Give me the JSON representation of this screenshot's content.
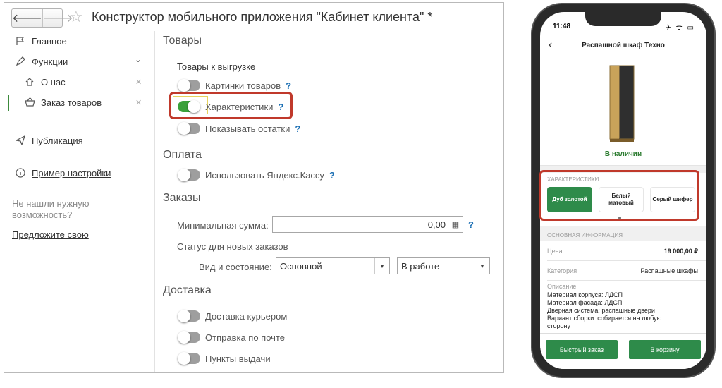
{
  "window": {
    "title": "Конструктор мобильного приложения \"Кабинет клиента\" *",
    "nav_back": "🡐",
    "nav_forward": "🡒"
  },
  "sidebar": {
    "items": [
      {
        "label": "Главное",
        "icon": "flag-icon"
      },
      {
        "label": "Функции",
        "icon": "pen-icon"
      },
      {
        "label": "О нас",
        "icon": "home-icon"
      },
      {
        "label": "Заказ товаров",
        "icon": "basket-icon"
      },
      {
        "label": "Публикация",
        "icon": "send-icon"
      },
      {
        "label": "Пример настройки",
        "icon": "info-icon"
      }
    ],
    "hint": "Не нашли нужную возможность?",
    "suggest_link": "Предложите свою"
  },
  "content": {
    "sections": {
      "goods": "Товары",
      "payment": "Оплата",
      "orders": "Заказы",
      "delivery": "Доставка"
    },
    "goods_export_link": "Товары к выгрузке",
    "toggles": {
      "product_images": {
        "label": "Картинки товаров",
        "on": false
      },
      "characteristics": {
        "label": "Характеристики",
        "on": true
      },
      "show_stock": {
        "label": "Показывать остатки",
        "on": false
      },
      "yandex_kassa": {
        "label": "Использовать Яндекс.Кассу",
        "on": false
      },
      "courier": {
        "label": "Доставка курьером",
        "on": false
      },
      "post": {
        "label": "Отправка по почте",
        "on": false
      },
      "pickup": {
        "label": "Пункты выдачи",
        "on": false
      }
    },
    "help_mark": "?",
    "min_sum_label": "Минимальная сумма:",
    "min_sum_value": "0,00",
    "status_label": "Статус для новых заказов",
    "view_state_label": "Вид и состояние:",
    "view_value": "Основной",
    "state_value": "В работе"
  },
  "phone": {
    "time": "11:48",
    "status_icons": "✈ ᯤ ▭",
    "title": "Распашной шкаф Техно",
    "in_stock": "В наличии",
    "characteristics_label": "ХАРАКТЕРИСТИКИ",
    "options": [
      "Дуб золотой",
      "Белый матовый",
      "Серый шифер"
    ],
    "main_info_label": "ОСНОВНАЯ ИНФОРМАЦИЯ",
    "price_label": "Цена",
    "price_value": "19 000,00 ₽",
    "category_label": "Категория",
    "category_value": "Распашные шкафы",
    "description_label": "Описание",
    "description_lines": [
      "Материал корпуса: ЛДСП",
      "Материал фасада: ЛДСП",
      "Дверная система: распашные двери",
      "Вариант сборки: собирается на любую",
      "сторону"
    ],
    "quick_order": "Быстрый заказ",
    "to_cart": "В корзину"
  },
  "colors": {
    "toggle_on": "#3aa13a",
    "accent_green": "#2e8b4a",
    "highlight_red": "#c0392b",
    "help_blue": "#1b6fb4"
  }
}
